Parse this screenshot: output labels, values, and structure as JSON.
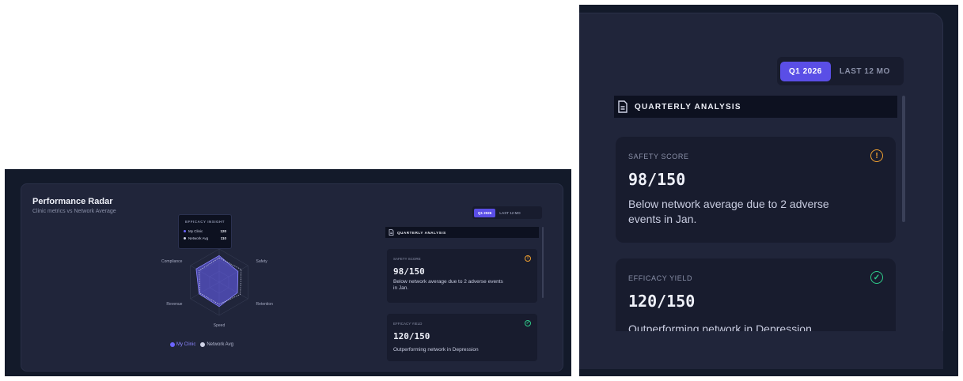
{
  "panel": {
    "title": "Performance Radar",
    "subtitle": "Clinic metrics vs Network Average"
  },
  "tooltip": {
    "title": "EFFICACY INSIGHT",
    "rows": [
      {
        "label": "My Clinic",
        "value": "120",
        "color": "#6b64ff"
      },
      {
        "label": "Network Avg",
        "value": "110",
        "color": "#cfd3e6"
      }
    ]
  },
  "radar": {
    "axes": [
      "Efficacy",
      "Safety",
      "Retention",
      "Speed",
      "Revenue",
      "Compliance"
    ],
    "max": 150,
    "series": [
      {
        "name": "My Clinic",
        "color": "#6b64ff",
        "values": [
          120,
          98,
          95,
          110,
          105,
          120
        ]
      },
      {
        "name": "Network Avg",
        "color": "#cfd3e6",
        "values": [
          110,
          115,
          110,
          100,
          100,
          105
        ]
      }
    ]
  },
  "legend": {
    "my_clinic": "My Clinic",
    "network_avg": "Network Avg"
  },
  "period_toggle": {
    "options": [
      "Q1 2026",
      "LAST 12 MO"
    ],
    "active": "Q1 2026"
  },
  "analysis": {
    "heading": "QUARTERLY ANALYSIS",
    "metrics": [
      {
        "label": "SAFETY SCORE",
        "value": "98/150",
        "description": "Below network average due to 2 adverse events in Jan.",
        "status": "warning",
        "status_color": "#f0a030"
      },
      {
        "label": "EFFICACY YIELD",
        "value": "120/150",
        "description": "Outperforming network in Depression",
        "status": "ok",
        "status_color": "#2ecc8a"
      }
    ]
  },
  "colors": {
    "accent": "#5a4ee6",
    "panel": "#20253a",
    "background": "#131a2a"
  }
}
